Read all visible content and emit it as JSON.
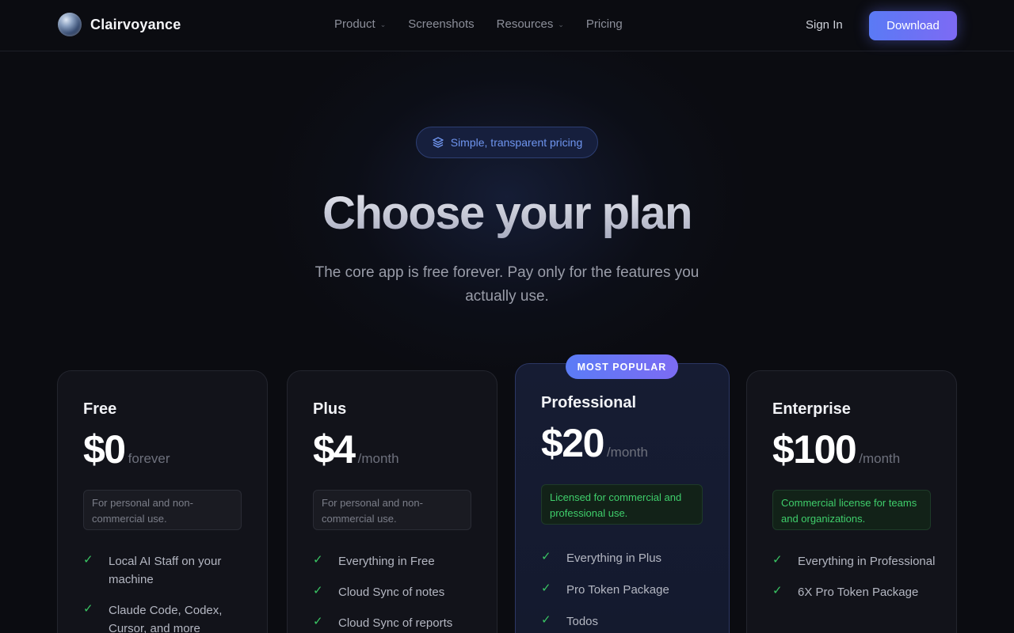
{
  "nav": {
    "brand": "Clairvoyance",
    "menu": [
      {
        "label": "Product",
        "dropdown": true
      },
      {
        "label": "Screenshots",
        "dropdown": false
      },
      {
        "label": "Resources",
        "dropdown": true
      },
      {
        "label": "Pricing",
        "dropdown": false
      }
    ],
    "sign_in": "Sign In",
    "download": "Download"
  },
  "hero": {
    "pill": "Simple, transparent pricing",
    "pill_icon": "layers-icon",
    "title": "Choose your plan",
    "subtitle": "The core app is free forever. Pay only for the features you actually use."
  },
  "plans": [
    {
      "name": "Free",
      "amount": "$0",
      "period": "forever",
      "license": "For personal and non-commercial use.",
      "features": [
        "Local AI Staff on your machine",
        "Claude Code, Codex, Cursor, and more"
      ]
    },
    {
      "name": "Plus",
      "amount": "$4",
      "period": "/month",
      "license": "For personal and non-commercial use.",
      "features": [
        "Everything in Free",
        "Cloud Sync of notes",
        "Cloud Sync of reports"
      ]
    },
    {
      "name": "Professional",
      "badge": "MOST POPULAR",
      "amount": "$20",
      "period": "/month",
      "license": "Licensed for commercial and professional use.",
      "features": [
        "Everything in Plus",
        "Pro Token Package",
        "Todos"
      ]
    },
    {
      "name": "Enterprise",
      "amount": "$100",
      "period": "/month",
      "license": "Commercial license for teams and organizations.",
      "features": [
        "Everything in Professional",
        "6X Pro Token Package"
      ]
    }
  ],
  "colors": {
    "background": "#0b0c11",
    "accent_start": "#5a7af5",
    "accent_end": "#7d6af4",
    "check": "#39c463",
    "commercial_green": "#3fce6b"
  }
}
